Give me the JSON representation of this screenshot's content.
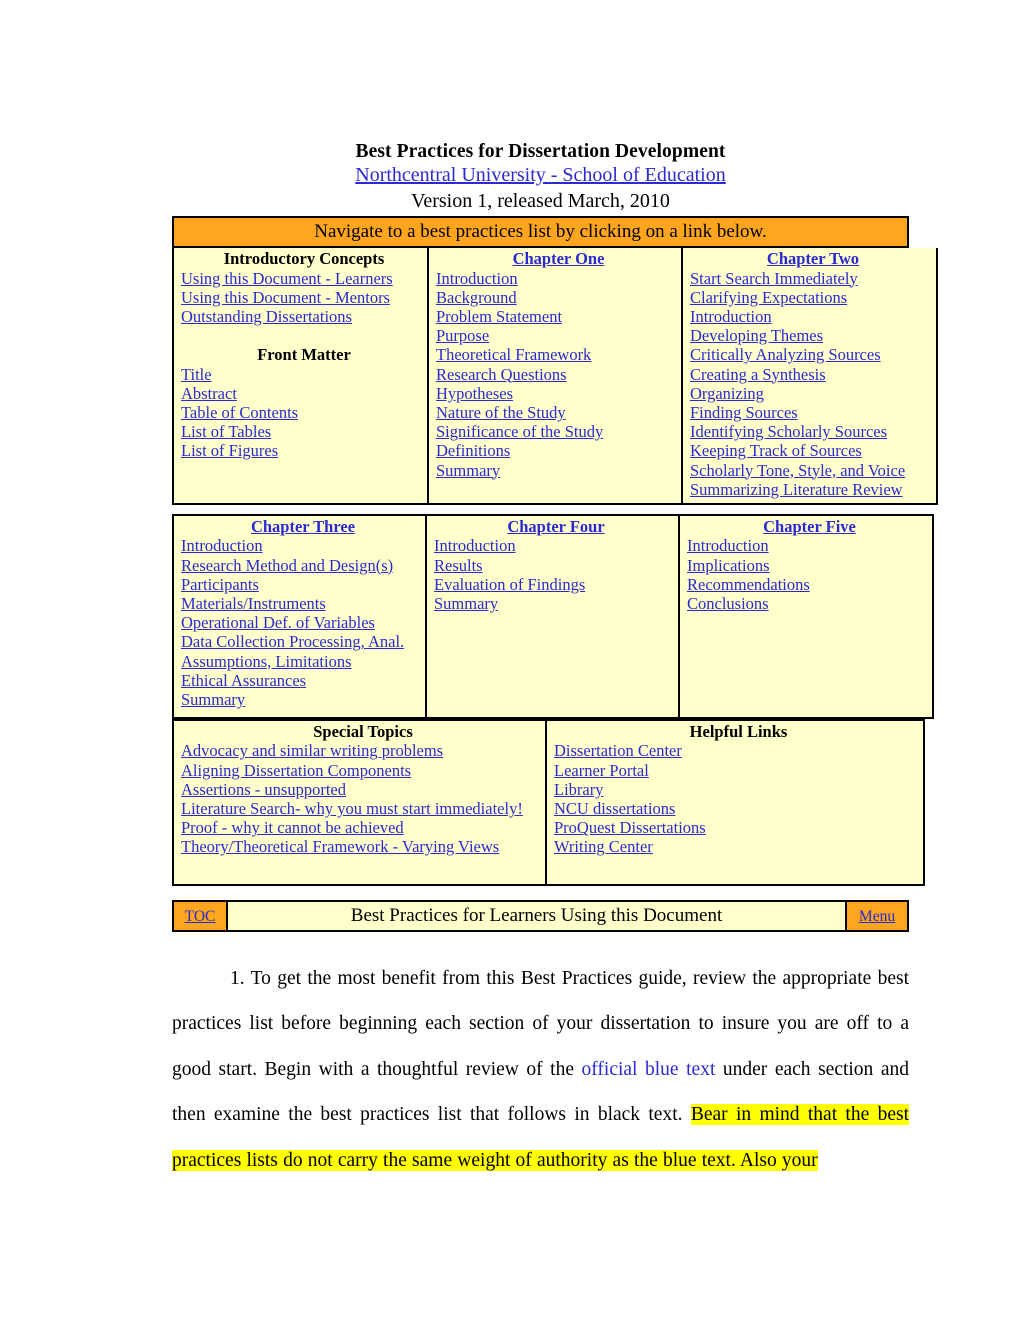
{
  "document": {
    "title": "Best Practices for Dissertation Development",
    "institution_link": "Northcentral University - School of Education",
    "version": "Version 1, released March, 2010",
    "nav_banner": "Navigate to a best practices list by clicking on a link below."
  },
  "colors": {
    "banner_orange": "#ffa51e",
    "table_cream": "#ffffcc",
    "link_blue": "#2a2ad0",
    "highlight_yellow": "#ffff00",
    "border_black": "#000000"
  },
  "table_one": {
    "columns": [
      {
        "heading": "Introductory Concepts",
        "heading_style": "black",
        "links": [
          "Using this Document - Learners",
          "Using this Document - Mentors",
          "Outstanding Dissertations"
        ],
        "subheading": "Front Matter",
        "sublinks": [
          "Title",
          "Abstract",
          "Table of Contents",
          "List of Tables",
          "List of Figures"
        ]
      },
      {
        "heading": "Chapter One",
        "heading_style": "blue",
        "links": [
          "Introduction",
          "Background",
          "Problem Statement",
          "Purpose",
          "Theoretical Framework",
          "Research Questions",
          "Hypotheses",
          "Nature of the Study",
          "Significance of the Study",
          "Definitions",
          "Summary"
        ]
      },
      {
        "heading": "Chapter Two",
        "heading_style": "blue",
        "links": [
          "Start Search Immediately",
          "Clarifying Expectations",
          "Introduction",
          "Developing Themes",
          "Critically Analyzing Sources",
          "Creating a Synthesis",
          "Organizing",
          "Finding Sources",
          "Identifying Scholarly Sources",
          "Keeping Track of Sources",
          "Scholarly Tone, Style, and Voice",
          "Summarizing Literature Review"
        ]
      }
    ]
  },
  "table_two": {
    "columns": [
      {
        "heading": "Chapter Three",
        "heading_style": "blue",
        "links": [
          "Introduction",
          "Research Method and Design(s)",
          "Participants",
          "Materials/Instruments",
          "Operational Def. of Variables",
          "Data Collection Processing, Anal.",
          "Assumptions, Limitations",
          "Ethical Assurances",
          "Summary"
        ]
      },
      {
        "heading": "Chapter Four",
        "heading_style": "blue",
        "links": [
          "Introduction",
          "Results",
          "Evaluation of Findings",
          "Summary"
        ]
      },
      {
        "heading": "Chapter Five",
        "heading_style": "blue",
        "links": [
          "Introduction",
          "Implications",
          "Recommendations",
          "Conclusions"
        ]
      }
    ]
  },
  "table_three": {
    "columns": [
      {
        "heading": "Special Topics",
        "heading_style": "black",
        "links": [
          "Advocacy and similar writing problems",
          "Aligning Dissertation Components",
          "Assertions - unsupported",
          "Literature Search- why you must start immediately!",
          "Proof - why it cannot be achieved",
          "Theory/Theoretical Framework - Varying Views"
        ]
      },
      {
        "heading": "Helpful Links",
        "heading_style": "black",
        "links": [
          "Dissertation Center",
          "Learner Portal",
          "Library",
          "NCU dissertations",
          "ProQuest Dissertations",
          "Writing Center"
        ]
      }
    ]
  },
  "toc_bar": {
    "toc_label": "TOC",
    "section_title": "Best Practices for Learners Using this Document",
    "menu_label": "Menu"
  },
  "body": {
    "seg1": "1. To get the most benefit from this Best Practices guide, review the appropriate best practices list before beginning each section of your dissertation to insure you are off to a good start. Begin with a thoughtful review of the ",
    "seg_blue": "official blue text",
    "seg2": " under each section and then examine the best practices list that follows in black text. ",
    "seg_hl": "Bear in mind that the best practices lists do not carry the same weight of authority as the blue text. Also your"
  }
}
